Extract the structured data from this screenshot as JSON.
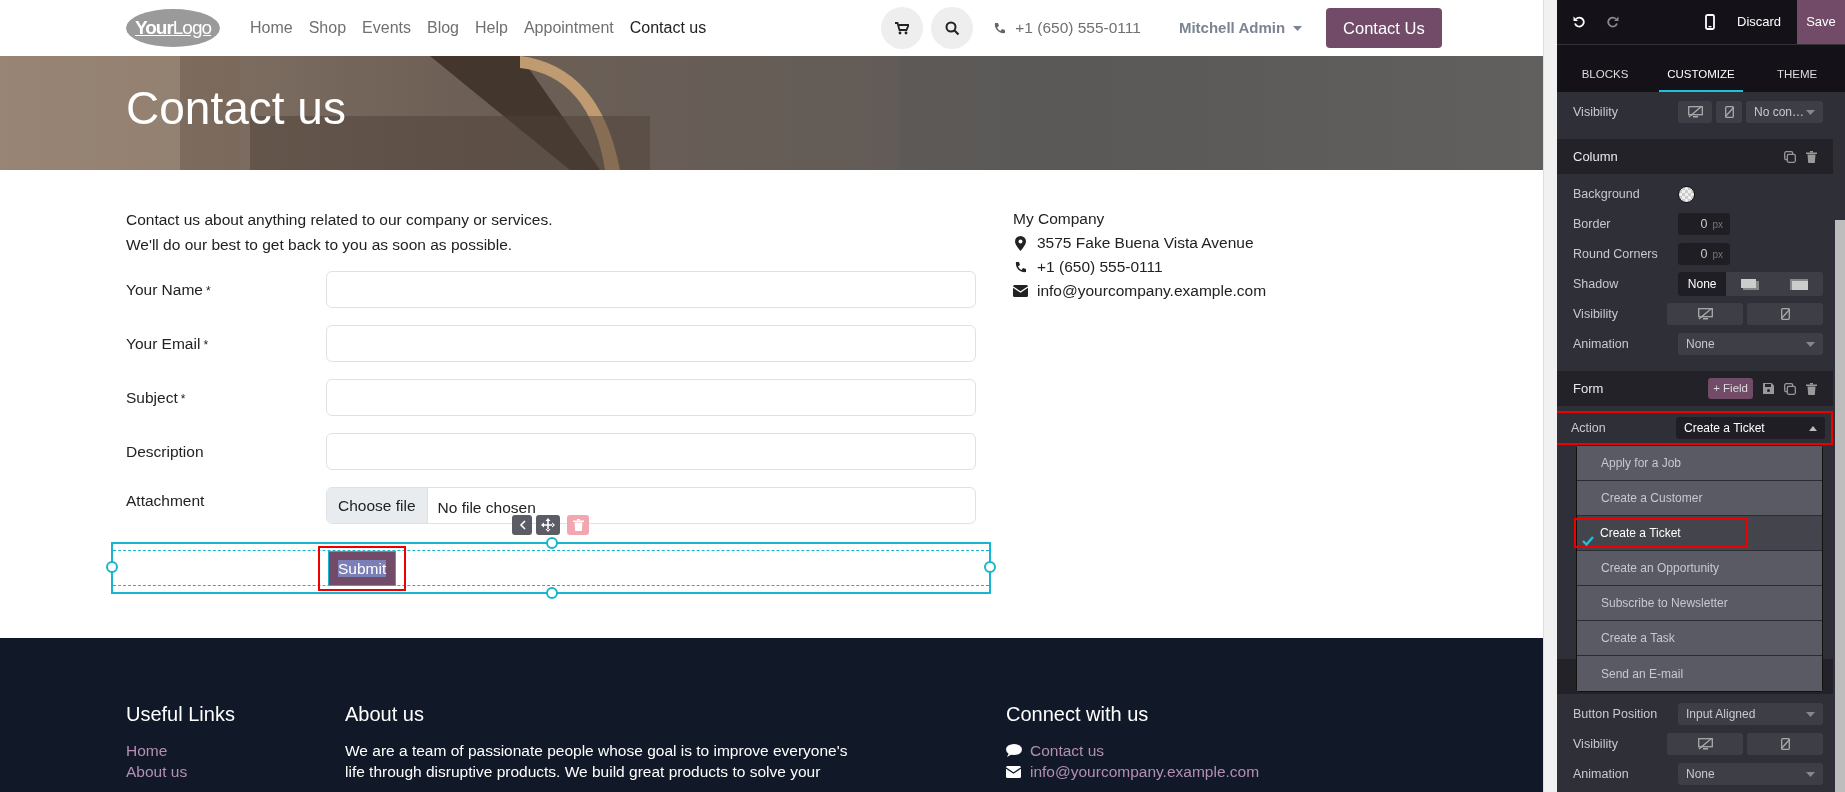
{
  "navbar": {
    "logo": "**Your**Logo",
    "menu": [
      {
        "label": "Home",
        "selected": false
      },
      {
        "label": "Shop",
        "selected": false
      },
      {
        "label": "Events",
        "selected": false
      },
      {
        "label": "Blog",
        "selected": false
      },
      {
        "label": "Help",
        "selected": false
      },
      {
        "label": "Appointment",
        "selected": false
      },
      {
        "label": "Contact us",
        "selected": true
      }
    ],
    "phone": "+1 (650) 555-0111",
    "user": "Mitchell Admin",
    "cta": "Contact Us"
  },
  "banner": {
    "title": "Contact us"
  },
  "intro": [
    "Contact us about anything related to our company or services.",
    "We'll do our best to get back to you as soon as possible."
  ],
  "form": {
    "fields": [
      {
        "kind": "text",
        "label": "Your Name",
        "mark": "*"
      },
      {
        "kind": "text",
        "label": "Your Email",
        "mark": "*"
      },
      {
        "kind": "text",
        "label": "Subject",
        "mark": "*"
      },
      {
        "kind": "text",
        "label": "Description"
      },
      {
        "kind": "file",
        "label": "Attachment",
        "button": "Choose file",
        "value": "No file chosen"
      }
    ],
    "submit": "Submit"
  },
  "company": {
    "name": "My Company",
    "lines": [
      {
        "kind": "address",
        "text": "3575 Fake Buena Vista Avenue"
      },
      {
        "kind": "phone",
        "text": "+1 (650) 555-0111"
      },
      {
        "kind": "email",
        "text": "info@yourcompany.example.com"
      }
    ]
  },
  "footer": {
    "columns": [
      {
        "kind": "links",
        "title": "Useful Links",
        "links": [
          "Home",
          "About us"
        ]
      },
      {
        "kind": "text",
        "title": "About us",
        "text": "We are a team of passionate people whose goal is to improve everyone's life through disruptive products. We build great products to solve your"
      },
      {
        "kind": "contacts",
        "title": "Connect with us",
        "items": [
          {
            "kind": "chat",
            "text": "Contact us"
          },
          {
            "kind": "email",
            "text": "info@yourcompany.example.com"
          }
        ]
      }
    ]
  },
  "editor": {
    "discard": "Discard",
    "save": "Save",
    "tabs": [
      {
        "label": "BLOCKS",
        "selected": false
      },
      {
        "label": "CUSTOMIZE",
        "selected": true
      },
      {
        "label": "THEME",
        "selected": false
      }
    ],
    "sections": [
      {
        "rows": [
          {
            "kind": "visibility",
            "label": "Visibility",
            "select": "No con…",
            "toggles": [
              {
                "selected": false
              },
              {
                "selected": false
              }
            ]
          }
        ]
      },
      {
        "kind": "plain",
        "title": "Column",
        "rows": [
          {
            "kind": "color",
            "label": "Background"
          },
          {
            "kind": "number",
            "label": "Border",
            "value": "0",
            "unit": "px"
          },
          {
            "kind": "number",
            "label": "Round Corners",
            "value": "0",
            "unit": "px"
          },
          {
            "kind": "shadow",
            "label": "Shadow",
            "options": [
              {
                "label": "None",
                "selected": true
              },
              {
                "kind": "outset",
                "selected": false
              },
              {
                "kind": "inset",
                "selected": false
              }
            ]
          },
          {
            "kind": "visibility",
            "label": "Visibility",
            "toggles": [
              {
                "selected": false
              },
              {
                "selected": false
              }
            ]
          },
          {
            "kind": "select",
            "label": "Animation",
            "value": "None"
          }
        ]
      },
      {
        "kind": "form",
        "title": "Form",
        "add": "+ Field",
        "rows": [
          {
            "kind": "select",
            "label": "Action",
            "value": "Create a Ticket",
            "expanded": true
          }
        ]
      },
      {
        "kind": "covered",
        "rows": [
          {
            "kind": "select",
            "label": "Button Position",
            "value": "Input Aligned"
          },
          {
            "kind": "visibility",
            "label": "Visibility",
            "toggles": [
              {
                "selected": false
              },
              {
                "selected": false
              }
            ]
          },
          {
            "kind": "select",
            "label": "Animation",
            "value": "None"
          }
        ]
      }
    ],
    "action_options": [
      {
        "label": "Apply for a Job",
        "selected": false
      },
      {
        "label": "Create a Customer",
        "selected": false
      },
      {
        "label": "Create a Ticket",
        "selected": true
      },
      {
        "label": "Create an Opportunity",
        "selected": false
      },
      {
        "label": "Subscribe to Newsletter",
        "selected": false
      },
      {
        "label": "Create a Task",
        "selected": false
      },
      {
        "label": "Send an E-mail",
        "selected": false
      }
    ]
  }
}
